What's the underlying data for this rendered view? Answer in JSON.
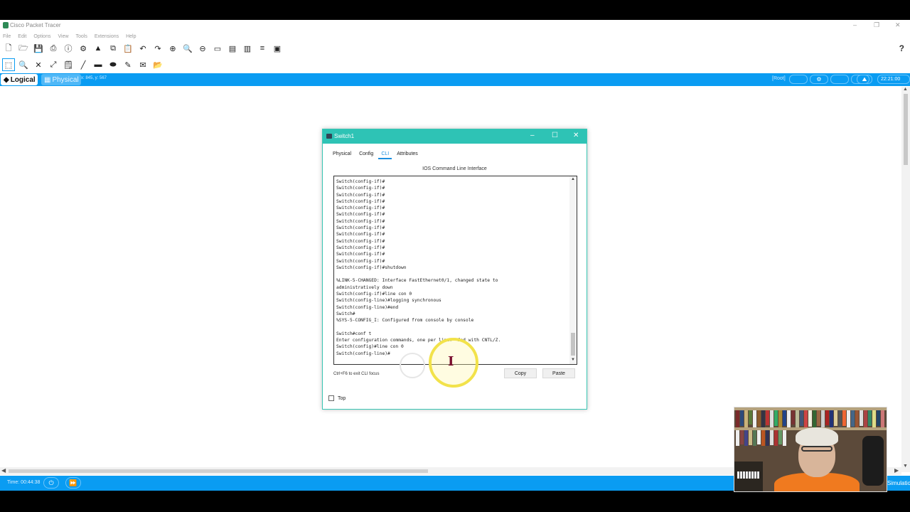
{
  "window": {
    "title": "Cisco Packet Tracer",
    "min": "–",
    "restore": "❐",
    "close": "✕"
  },
  "menu": [
    "File",
    "Edit",
    "Options",
    "View",
    "Tools",
    "Extensions",
    "Help"
  ],
  "help_label": "?",
  "nav": {
    "logical": "Logical",
    "physical": "Physical",
    "coords": "x: 845, y: 567",
    "root": "[Root]",
    "clock": "22:21:00"
  },
  "bottom": {
    "time": "Time: 00:44:38",
    "simulation": "Simulation"
  },
  "dialog": {
    "title": "Switch1",
    "tabs": [
      "Physical",
      "Config",
      "CLI",
      "Attributes"
    ],
    "active_tab": "CLI",
    "heading": "IOS Command Line Interface",
    "console_lines": [
      "Switch(config-if)#",
      "Switch(config-if)#",
      "Switch(config-if)#",
      "Switch(config-if)#",
      "Switch(config-if)#",
      "Switch(config-if)#",
      "Switch(config-if)#",
      "Switch(config-if)#",
      "Switch(config-if)#",
      "Switch(config-if)#",
      "Switch(config-if)#",
      "Switch(config-if)#",
      "Switch(config-if)#",
      "Switch(config-if)#shutdown",
      "",
      "%LINK-5-CHANGED: Interface FastEthernet0/1, changed state to",
      "administratively down",
      "Switch(config-if)#line con 0",
      "Switch(config-line)#logging synchronous",
      "Switch(config-line)#end",
      "Switch#",
      "%SYS-5-CONFIG_I: Configured from console by console",
      "",
      "Switch#conf t",
      "Enter configuration commands, one per line.  End with CNTL/Z.",
      "Switch(config)#line con 0",
      "Switch(config-line)#"
    ],
    "hint": "Ctrl+F6 to exit CLI focus",
    "copy": "Copy",
    "paste": "Paste",
    "top_label": "Top",
    "top_checked": false
  },
  "colors": {
    "accent_bar": "#0a9cf2",
    "dialog_title": "#2ec3b5",
    "cursor_highlight": "#f2e24a"
  }
}
